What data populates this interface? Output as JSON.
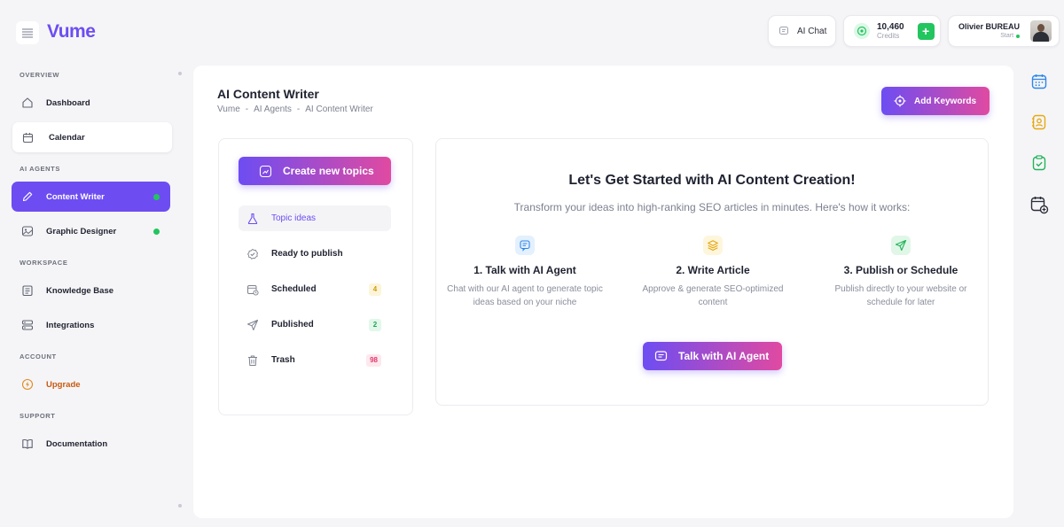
{
  "app": {
    "name": "Vume"
  },
  "topbar": {
    "ai_chat_label": "AI Chat",
    "credits_value": "10,460",
    "credits_label": "Credits",
    "add_credits_symbol": "+",
    "user_name": "Olivier BUREAU",
    "user_plan": "Start"
  },
  "sidebar": {
    "sections": {
      "overview": "OVERVIEW",
      "ai_agents": "AI AGENTS",
      "workspace": "WORKSPACE",
      "account": "ACCOUNT",
      "support": "SUPPORT"
    },
    "items": {
      "dashboard": "Dashboard",
      "calendar": "Calendar",
      "content_writer": "Content Writer",
      "graphic_designer": "Graphic Designer",
      "knowledge_base": "Knowledge Base",
      "integrations": "Integrations",
      "upgrade": "Upgrade",
      "documentation": "Documentation"
    }
  },
  "header": {
    "title": "AI Content Writer",
    "breadcrumb": [
      "Vume",
      "-",
      "AI Agents",
      "-",
      "AI Content Writer"
    ],
    "add_keywords_label": "Add Keywords"
  },
  "topics": {
    "create_label": "Create new topics",
    "items": [
      {
        "label": "Topic ideas",
        "count": null
      },
      {
        "label": "Ready to publish",
        "count": null
      },
      {
        "label": "Scheduled",
        "count": "4"
      },
      {
        "label": "Published",
        "count": "2"
      },
      {
        "label": "Trash",
        "count": "98"
      }
    ]
  },
  "getting_started": {
    "title": "Let's Get Started with AI Content Creation!",
    "subtitle": "Transform your ideas into high-ranking SEO articles in minutes. Here's how it works:",
    "steps": [
      {
        "title": "1. Talk with AI Agent",
        "desc": "Chat with our AI agent to generate topic ideas based on your niche",
        "icon": "chat-icon"
      },
      {
        "title": "2. Write Article",
        "desc": "Approve & generate SEO-optimized content",
        "icon": "layers-icon"
      },
      {
        "title": "3. Publish or Schedule",
        "desc": "Publish directly to your website or schedule for later",
        "icon": "send-icon"
      }
    ],
    "cta_label": "Talk with AI Agent"
  },
  "colors": {
    "brand": "#6d4df2",
    "gradient_end": "#e04aa1",
    "success": "#22c55e",
    "upgrade": "#c8590f"
  }
}
